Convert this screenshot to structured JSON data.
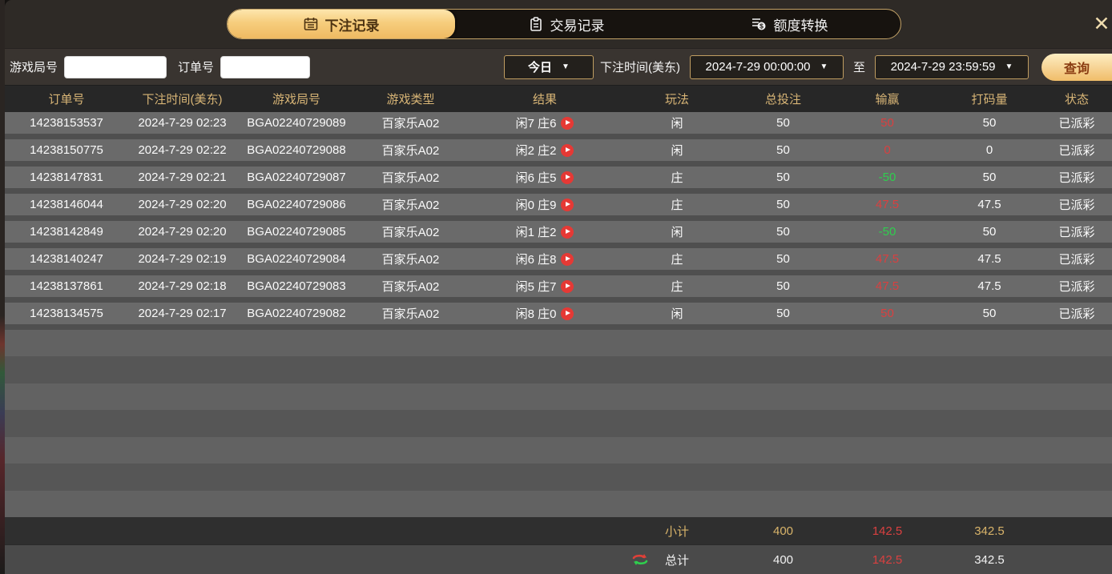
{
  "modal": {
    "close_icon": "✕"
  },
  "tabs": [
    {
      "label": "下注记录",
      "icon": "calendar-icon",
      "active": true
    },
    {
      "label": "交易记录",
      "icon": "clipboard-icon",
      "active": false
    },
    {
      "label": "额度转换",
      "icon": "coin-transfer-icon",
      "active": false
    }
  ],
  "filters": {
    "game_round_label": "游戏局号",
    "game_round_value": "",
    "order_no_label": "订单号",
    "order_no_value": "",
    "date_preset": "今日",
    "bet_time_label": "下注时间(美东)",
    "start_time": "2024-7-29 00:00:00",
    "to_label": "至",
    "end_time": "2024-7-29 23:59:59",
    "search_label": "查询",
    "dropdown_arrow": "▼"
  },
  "table": {
    "headers": [
      "订单号",
      "下注时间(美东)",
      "游戏局号",
      "游戏类型",
      "结果",
      "玩法",
      "总投注",
      "输赢",
      "打码量",
      "状态"
    ],
    "rows": [
      {
        "order_no": "14238153537",
        "bet_time": "2024-7-29 02:23",
        "game_round": "BGA02240729089",
        "game_type": "百家乐A02",
        "result": "闲7 庄6",
        "play": "闲",
        "total_bet": "50",
        "win_loss": "50",
        "win_loss_color": "red",
        "turnover": "50",
        "status": "已派彩"
      },
      {
        "order_no": "14238150775",
        "bet_time": "2024-7-29 02:22",
        "game_round": "BGA02240729088",
        "game_type": "百家乐A02",
        "result": "闲2 庄2",
        "play": "闲",
        "total_bet": "50",
        "win_loss": "0",
        "win_loss_color": "red",
        "turnover": "0",
        "status": "已派彩"
      },
      {
        "order_no": "14238147831",
        "bet_time": "2024-7-29 02:21",
        "game_round": "BGA02240729087",
        "game_type": "百家乐A02",
        "result": "闲6 庄5",
        "play": "庄",
        "total_bet": "50",
        "win_loss": "-50",
        "win_loss_color": "green",
        "turnover": "50",
        "status": "已派彩"
      },
      {
        "order_no": "14238146044",
        "bet_time": "2024-7-29 02:20",
        "game_round": "BGA02240729086",
        "game_type": "百家乐A02",
        "result": "闲0 庄9",
        "play": "庄",
        "total_bet": "50",
        "win_loss": "47.5",
        "win_loss_color": "red",
        "turnover": "47.5",
        "status": "已派彩"
      },
      {
        "order_no": "14238142849",
        "bet_time": "2024-7-29 02:20",
        "game_round": "BGA02240729085",
        "game_type": "百家乐A02",
        "result": "闲1 庄2",
        "play": "闲",
        "total_bet": "50",
        "win_loss": "-50",
        "win_loss_color": "green",
        "turnover": "50",
        "status": "已派彩"
      },
      {
        "order_no": "14238140247",
        "bet_time": "2024-7-29 02:19",
        "game_round": "BGA02240729084",
        "game_type": "百家乐A02",
        "result": "闲6 庄8",
        "play": "庄",
        "total_bet": "50",
        "win_loss": "47.5",
        "win_loss_color": "red",
        "turnover": "47.5",
        "status": "已派彩"
      },
      {
        "order_no": "14238137861",
        "bet_time": "2024-7-29 02:18",
        "game_round": "BGA02240729083",
        "game_type": "百家乐A02",
        "result": "闲5 庄7",
        "play": "庄",
        "total_bet": "50",
        "win_loss": "47.5",
        "win_loss_color": "red",
        "turnover": "47.5",
        "status": "已派彩"
      },
      {
        "order_no": "14238134575",
        "bet_time": "2024-7-29 02:17",
        "game_round": "BGA02240729082",
        "game_type": "百家乐A02",
        "result": "闲8 庄0",
        "play": "闲",
        "total_bet": "50",
        "win_loss": "50",
        "win_loss_color": "red",
        "turnover": "50",
        "status": "已派彩"
      }
    ],
    "empty_row_count": 7,
    "subtotal": {
      "label": "小计",
      "total_bet": "400",
      "win_loss": "142.5",
      "win_loss_color": "red",
      "turnover": "342.5"
    },
    "total": {
      "label": "总计",
      "total_bet": "400",
      "win_loss": "142.5",
      "win_loss_color": "red",
      "turnover": "342.5"
    }
  },
  "colors": {
    "accent_gold": "#d8b576",
    "active_tab_gold": "#f0bd69",
    "win_red": "#d94040",
    "loss_green": "#2fce4e"
  }
}
